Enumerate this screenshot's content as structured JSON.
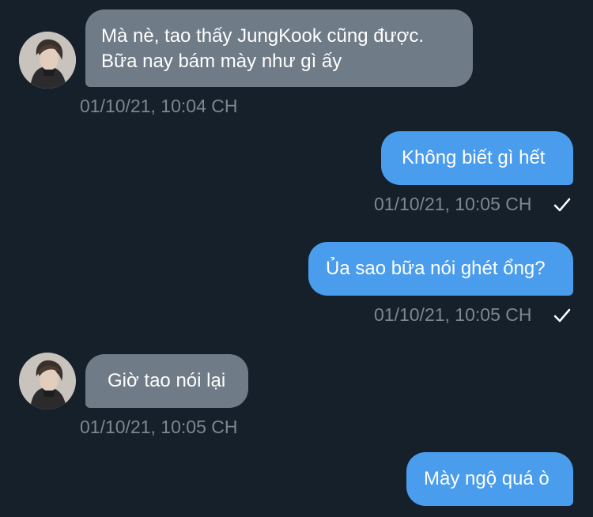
{
  "theme": {
    "background": "#15202b",
    "incoming_bubble": "#6f7b87",
    "outgoing_bubble": "#4a9ced",
    "timestamp_color": "#7c8792"
  },
  "messages": [
    {
      "direction": "incoming",
      "text": "Mà nè, tao thấy JungKook cũng được.\nBữa nay bám mày như gì ấy",
      "time": "01/10/21, 10:04 CH",
      "avatar_icon": "user-avatar-icon"
    },
    {
      "direction": "outgoing",
      "text": "Không biết gì hết",
      "time": "01/10/21, 10:05 CH",
      "status_icon": "read-check-icon"
    },
    {
      "direction": "outgoing",
      "text": "Ủa sao bữa nói ghét ổng?",
      "time": "01/10/21, 10:05 CH",
      "status_icon": "read-check-icon"
    },
    {
      "direction": "incoming",
      "text": "Giờ tao nói lại",
      "time": "01/10/21, 10:05 CH",
      "avatar_icon": "user-avatar-icon"
    },
    {
      "direction": "outgoing",
      "text": "Mày ngộ quá ò"
    }
  ]
}
